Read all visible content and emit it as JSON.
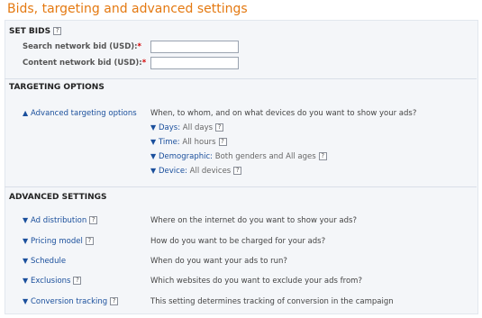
{
  "title": "Bids, targeting and advanced settings",
  "help_glyph": "?",
  "required_mark": "*",
  "set_bids": {
    "title": "SET BIDS",
    "search_label": "Search network bid (USD):",
    "search_value": "",
    "content_label": "Content network bid (USD):",
    "content_value": ""
  },
  "targeting": {
    "title": "TARGETING OPTIONS",
    "advanced_label": "Advanced targeting options",
    "description": "When, to whom, and on what devices do you want to show your ads?",
    "options": [
      {
        "key": "Days:",
        "value": "All days"
      },
      {
        "key": "Time:",
        "value": "All hours"
      },
      {
        "key": "Demographic:",
        "value": "Both genders and All ages"
      },
      {
        "key": "Device:",
        "value": "All devices"
      }
    ]
  },
  "advanced": {
    "title": "ADVANCED SETTINGS",
    "items": [
      {
        "label": "Ad distribution",
        "help": true,
        "description": "Where on the internet do you want to show your ads?"
      },
      {
        "label": "Pricing model",
        "help": true,
        "description": "How do you want to be charged for your ads?"
      },
      {
        "label": "Schedule",
        "help": false,
        "description": "When do you want your ads to run?"
      },
      {
        "label": "Exclusions",
        "help": true,
        "description": "Which websites do you want to exclude your ads from?"
      },
      {
        "label": "Conversion tracking",
        "help": true,
        "description": "This setting determines tracking of conversion in the campaign"
      }
    ]
  },
  "icons": {
    "expand": "chevron-down-icon",
    "collapse": "chevron-up-icon",
    "help": "help-icon"
  }
}
